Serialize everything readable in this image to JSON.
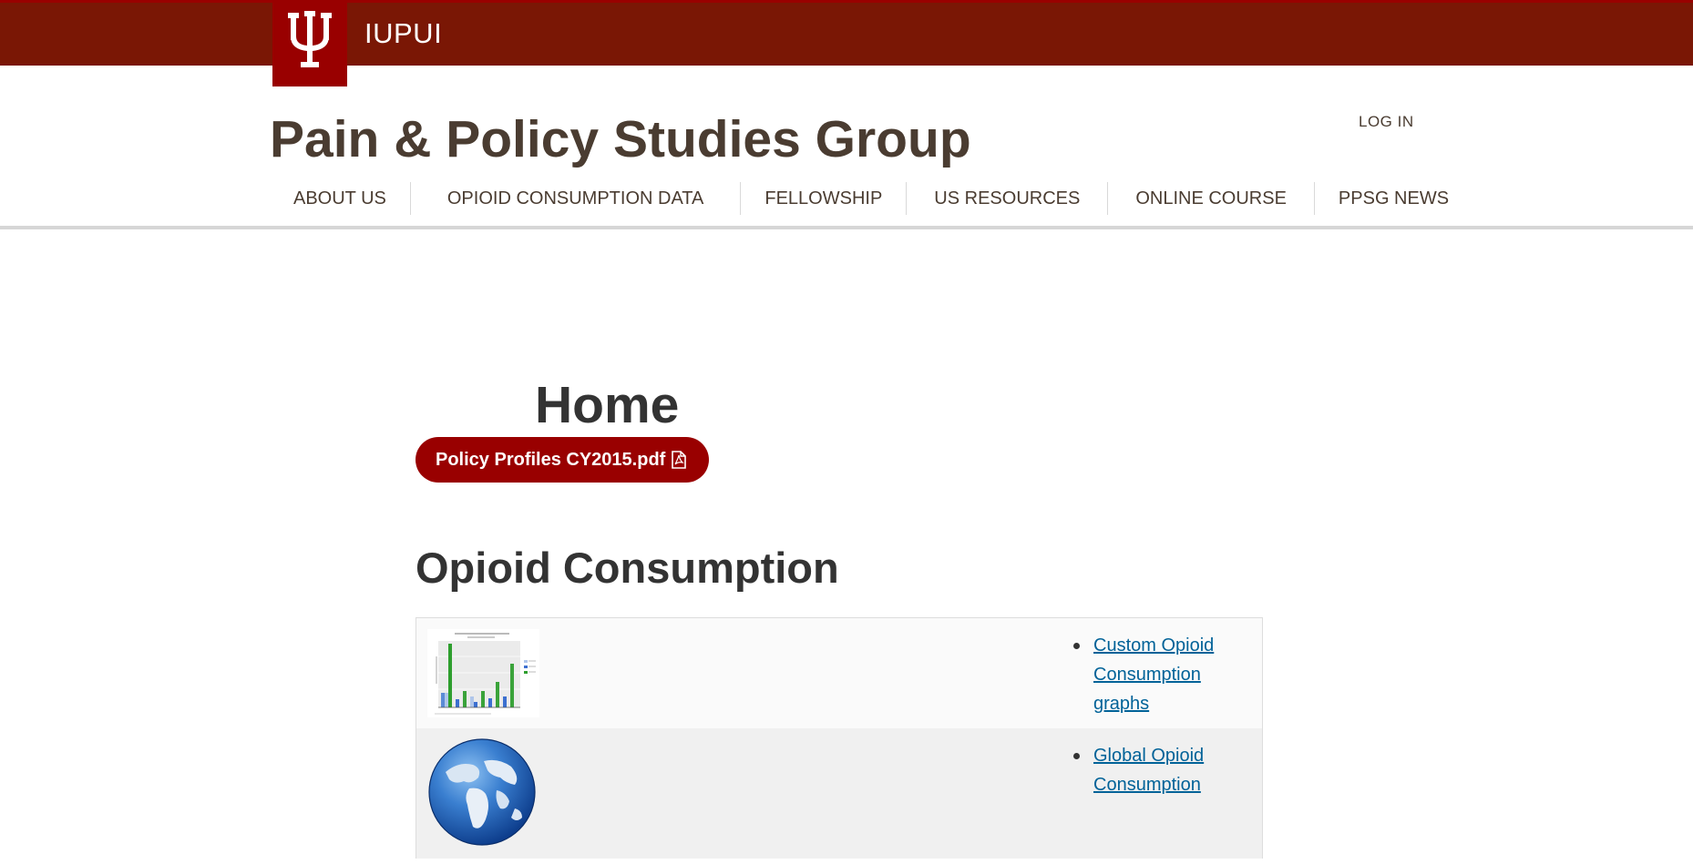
{
  "brand": {
    "name": "IUPUI",
    "colors": {
      "bar": "#7a1705",
      "crimson": "#990000"
    }
  },
  "site": {
    "title": "Pain & Policy Studies Group",
    "login_label": "LOG IN"
  },
  "nav": {
    "items": [
      {
        "label": "ABOUT US"
      },
      {
        "label": "OPIOID CONSUMPTION DATA"
      },
      {
        "label": "FELLOWSHIP"
      },
      {
        "label": "US RESOURCES"
      },
      {
        "label": "ONLINE COURSE"
      },
      {
        "label": "PPSG NEWS"
      }
    ]
  },
  "main": {
    "page_title": "Home",
    "pdf_button": {
      "label": "Policy Profiles CY2015.pdf",
      "icon": "pdf-icon"
    },
    "section_title": "Opioid Consumption",
    "rows": [
      {
        "image": "bar-chart-thumbnail",
        "link": "Custom Opioid Consumption graphs"
      },
      {
        "image": "globe-image",
        "link": "Global Opioid Consumption"
      }
    ]
  }
}
